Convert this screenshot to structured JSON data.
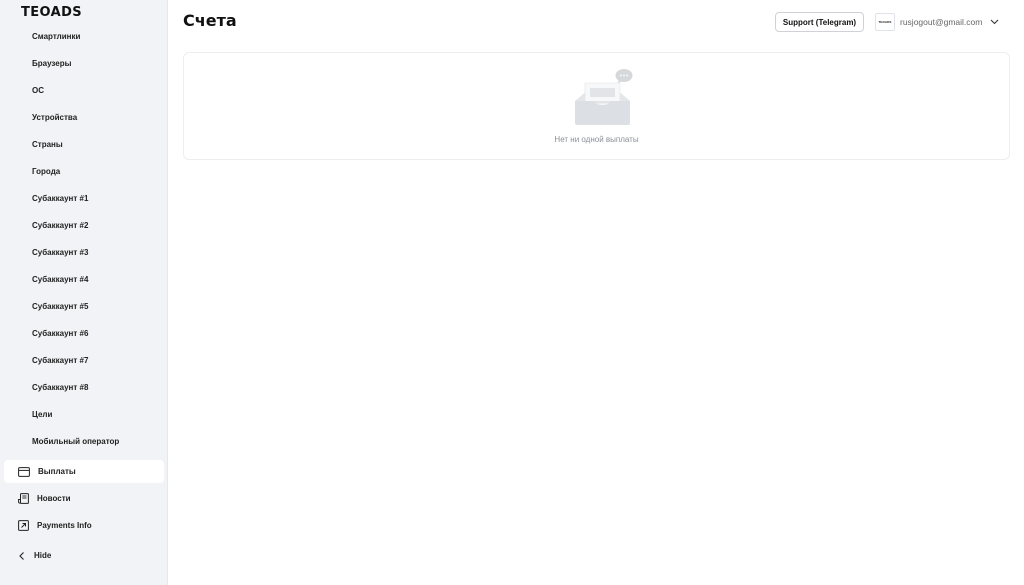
{
  "brand": {
    "logo": "TEOADS"
  },
  "sidebar": {
    "sub_items": [
      "Смартлинки",
      "Браузеры",
      "ОС",
      "Устройства",
      "Страны",
      "Города",
      "Субаккаунт #1",
      "Субаккаунт #2",
      "Субаккаунт #3",
      "Субаккаунт #4",
      "Субаккаунт #5",
      "Субаккаунт #6",
      "Субаккаунт #7",
      "Субаккаунт #8",
      "Цели",
      "Мобильный оператор"
    ],
    "nav": [
      {
        "label": "Выплаты",
        "icon": "card-icon",
        "active": true
      },
      {
        "label": "Новости",
        "icon": "news-icon",
        "active": false
      },
      {
        "label": "Payments Info",
        "icon": "external-link-icon",
        "active": false
      },
      {
        "label": "Hide",
        "icon": "chevron-left-icon",
        "active": false
      }
    ]
  },
  "header": {
    "title": "Счета",
    "support_label": "Support (Telegram)",
    "account_logo": "TEOADS",
    "account_email": "rusjogout@gmail.com"
  },
  "empty_state": {
    "message": "Нет ни одной выплаты",
    "icon": "empty-inbox-icon"
  }
}
